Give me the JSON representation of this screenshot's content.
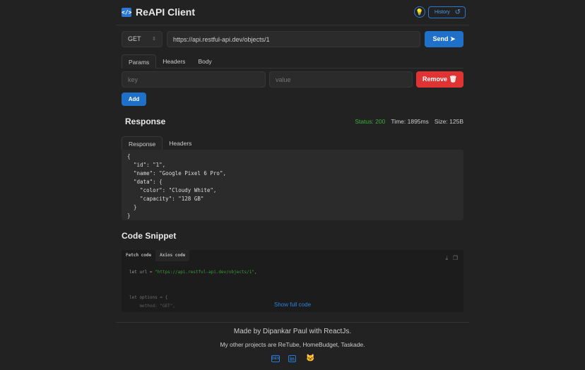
{
  "header": {
    "title": "ReAPI Client",
    "logo_icon": "</>",
    "theme_icon": "lightbulb-icon",
    "history_label": "History"
  },
  "request": {
    "method": "GET",
    "url": "https://api.restful-api.dev/objects/1",
    "send_label": "Send",
    "tabs": [
      "Params",
      "Headers",
      "Body"
    ],
    "key_placeholder": "key",
    "value_placeholder": "value",
    "remove_label": "Remove",
    "add_label": "Add"
  },
  "response": {
    "heading": "Response",
    "status": "Status: 200",
    "time": "Time: 1895ms",
    "size": "Size: 125B",
    "tabs": [
      "Response",
      "Headers"
    ],
    "body": "{\n  \"id\": \"1\",\n  \"name\": \"Google Pixel 6 Pro\",\n  \"data\": {\n    \"color\": \"Cloudy White\",\n    \"capacity\": \"128 GB\"\n  }\n}"
  },
  "snippet": {
    "heading": "Code Snippet",
    "tabs": [
      "Fetch code",
      "Axios code"
    ],
    "line1_prefix": "let url = ",
    "line1_string": "\"https://api.restful-api.dev/objects/1\"",
    "line1_suffix": ",",
    "line2": "let options = {",
    "line3": "    method: \"GET\",",
    "show_full": "Show full code"
  },
  "footer": {
    "credit": "Made by Dipankar Paul with ReactJs.",
    "projects": "My other projects are ReTube, HomeBudget, Taskade.",
    "icons": [
      "dev-icon",
      "linkedin-icon",
      "github-icon"
    ]
  },
  "colors": {
    "accent": "#1e70c8",
    "danger": "#e03434",
    "success": "#3ab03a",
    "background": "#222222"
  }
}
